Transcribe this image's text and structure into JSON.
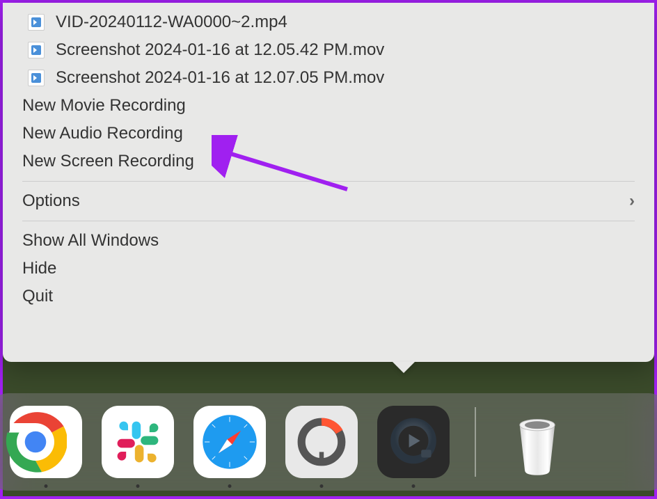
{
  "menu": {
    "recent_files": [
      {
        "name": "VID-20240112-WA0000~2.mp4"
      },
      {
        "name": "Screenshot 2024-01-16 at 12.05.42 PM.mov"
      },
      {
        "name": "Screenshot 2024-01-16 at 12.07.05 PM.mov"
      }
    ],
    "new_movie": "New Movie Recording",
    "new_audio": "New Audio Recording",
    "new_screen": "New Screen Recording",
    "options": "Options",
    "show_all": "Show All Windows",
    "hide": "Hide",
    "quit": "Quit"
  },
  "dock": {
    "chrome": "Google Chrome",
    "slack": "Slack",
    "safari": "Safari",
    "screenshot": "Screenshot Tool",
    "quicktime": "QuickTime Player",
    "trash": "Trash"
  },
  "annotation": {
    "arrow_color": "#a020f0"
  }
}
